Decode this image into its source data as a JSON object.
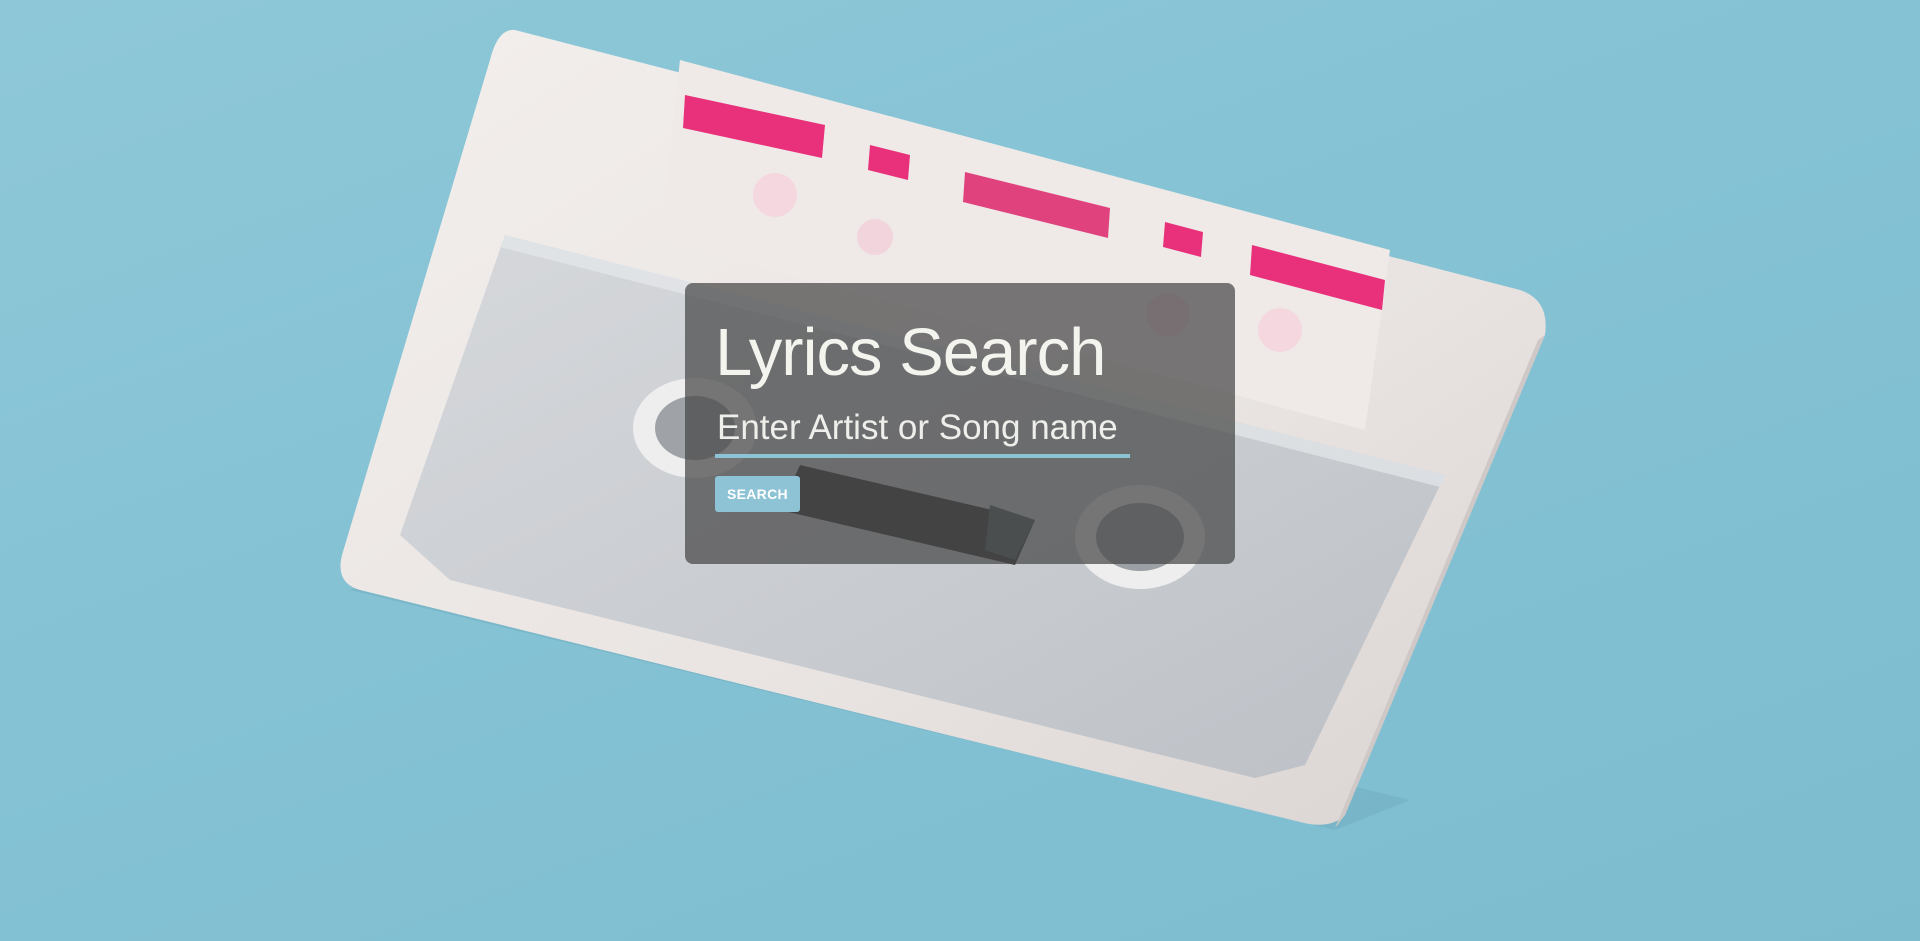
{
  "page": {
    "title": "Lyrics Search"
  },
  "search": {
    "placeholder": "Enter Artist or Song name",
    "button_label": "SEARCH"
  },
  "background": {
    "subject": "white cassette tape with pink tape on a light blue surface",
    "colors": {
      "surface": "#86c3d5",
      "cassette_shell": "#ece8e6",
      "cassette_window": "#c9ccd0",
      "tape": "#e8317a",
      "panel": "#464646",
      "accent": "#8ec3d6"
    }
  }
}
